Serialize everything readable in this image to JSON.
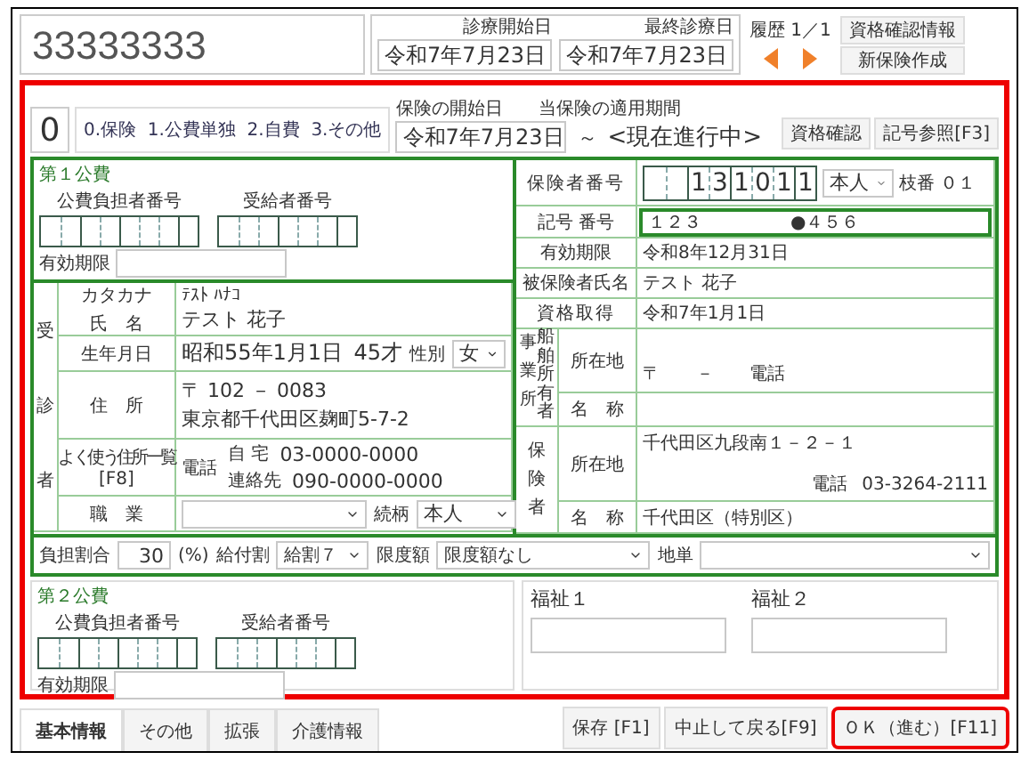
{
  "patient_id": "33333333",
  "visit_dates": [
    {
      "label": "診療開始日",
      "value": "令和7年7月23日"
    },
    {
      "label": "最終診療日",
      "value": "令和7年7月23日"
    }
  ],
  "history": {
    "label": "履歴",
    "count": "1／1"
  },
  "header_buttons": [
    "資格確認情報",
    "新保険作成"
  ],
  "category": {
    "value": "0",
    "options": "0.保険  1.公費単独  2.自費  3.その他"
  },
  "period": {
    "start_label": "保険の開始日",
    "range_label": "当保険の適用期間",
    "start": "令和7年7月23日",
    "tilde": "～",
    "end": "<現在進行中>"
  },
  "period_buttons": [
    "資格確認",
    "記号参照[F3]"
  ],
  "public_expense_1": {
    "title": "第１公費",
    "payer_label": "公費負担者番号",
    "recipient_label": "受給者番号",
    "expiry_label": "有効期限"
  },
  "patient": {
    "section": "受診者",
    "kana_label": "カタカナ",
    "name_label": "氏　名",
    "kana": "ﾃｽﾄ ﾊﾅｺ",
    "name": "テスト 花子",
    "birth_label": "生年月日",
    "birth": "昭和55年1月1日",
    "age": "45才",
    "sex_label": "性別",
    "sex": "女",
    "address_label": "住　所",
    "address_list": "よく使う住所一覧",
    "address_key": "[F8]",
    "postal_mark": "〒",
    "postal": "102 － 0083",
    "address": "東京都千代田区麹町5-7-2",
    "phone_label": "電話",
    "home_label": "自 宅",
    "home": "03-0000-0000",
    "contact_label": "連絡先",
    "contact": "090-0000-0000",
    "job_label": "職　業",
    "relation_label": "続柄",
    "relation": "本人"
  },
  "insurance": {
    "insurer_label": "保険者番号",
    "insurer_number": "131011",
    "holder": "本人",
    "branch_label": "枝番",
    "branch": "０１",
    "symbol_label": "記号 番号",
    "symbol": "１２３",
    "number": "●４５６",
    "expiry_label": "有効期限",
    "expiry": "令和8年12月31日",
    "insured_label": "被保険者氏名",
    "insured": "テスト 花子",
    "acquired_label": "資格取得",
    "acquired": "令和7年1月1日"
  },
  "employer": {
    "side_label": "事業所",
    "side_label_2": "船舶所有者",
    "address_label": "所在地",
    "postal_mark": "〒",
    "postal_dash": "－",
    "phone_label": "電話",
    "name_label": "名　称"
  },
  "insurer": {
    "side_label": "保険者",
    "address_label": "所在地",
    "address": "千代田区九段南１－２－１",
    "phone_label": "電話",
    "phone": "03-3264-2111",
    "name_label": "名　称",
    "name": "千代田区（特別区）"
  },
  "burden": {
    "label": "負担割合",
    "value": "30",
    "unit": "(%)",
    "benefit_label": "給付割",
    "benefit": "給割７",
    "limit_label": "限度額",
    "limit": "限度額なし",
    "local_label": "地単"
  },
  "public_expense_2": {
    "title": "第２公費",
    "payer_label": "公費負担者番号",
    "recipient_label": "受給者番号",
    "expiry_label": "有効期限"
  },
  "welfare": [
    {
      "label": "福祉１"
    },
    {
      "label": "福祉２"
    }
  ],
  "tabs": [
    {
      "label": "基本情報",
      "selected": true
    },
    {
      "label": "その他",
      "selected": false
    },
    {
      "label": "拡張",
      "selected": false
    },
    {
      "label": "介護情報",
      "selected": false
    }
  ],
  "footer_buttons": [
    {
      "label": "保存 [F1]",
      "primary": false
    },
    {
      "label": "中止して戻る[F9]",
      "primary": false
    },
    {
      "label": "ＯＫ（進む）[F11]",
      "primary": true
    }
  ]
}
